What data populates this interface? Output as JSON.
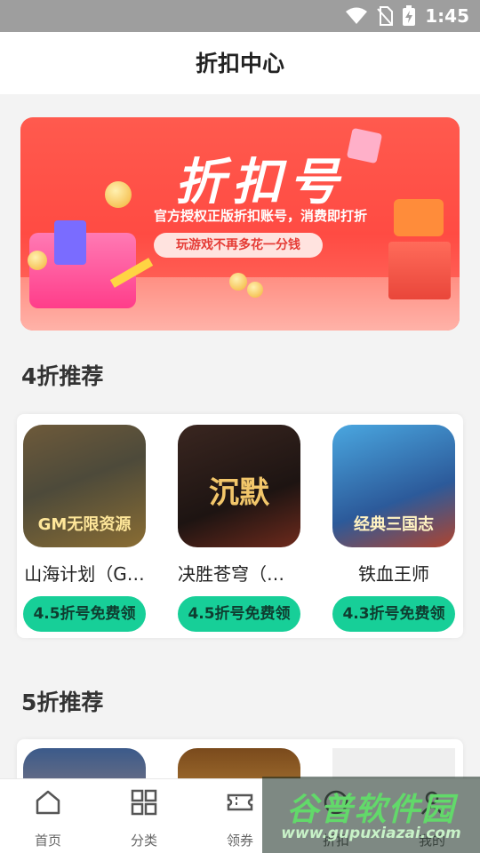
{
  "status_bar": {
    "time": "1:45"
  },
  "header": {
    "title": "折扣中心"
  },
  "banner": {
    "title": "折扣号",
    "subtitle": "官方授权正版折扣账号，消费即打折",
    "tagline": "玩游戏不再多花一分钱"
  },
  "section_4": {
    "title": "4折推荐",
    "games": [
      {
        "name": "山海计划（G…",
        "icon_badge": "GM无限资源",
        "button": "4.5折号免费领"
      },
      {
        "name": "决胜苍穹（沉…",
        "icon_badge": "沉默",
        "button": "4.5折号免费领"
      },
      {
        "name": "铁血王师",
        "icon_badge": "经典三国志",
        "button": "4.3折号免费领"
      }
    ]
  },
  "section_5": {
    "title": "5折推荐"
  },
  "tabbar": {
    "items": [
      {
        "label": "首页",
        "icon": "home-icon"
      },
      {
        "label": "分类",
        "icon": "grid-icon"
      },
      {
        "label": "领券",
        "icon": "ticket-icon"
      },
      {
        "label": "折扣",
        "icon": "discount-icon"
      },
      {
        "label": "我的",
        "icon": "user-icon"
      }
    ]
  },
  "watermark": {
    "title": "谷普软件园",
    "url": "www.gupuxiazai.com"
  },
  "colors": {
    "accent": "#17cf98",
    "banner": "#ff4b43",
    "status_bar": "#9e9e9e"
  }
}
